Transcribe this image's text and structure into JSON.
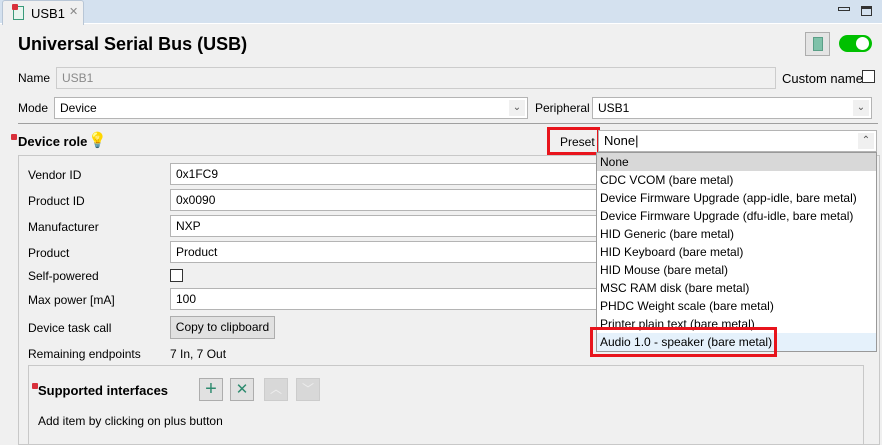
{
  "tab": {
    "label": "USB1"
  },
  "title": "Universal Serial Bus (USB)",
  "name": {
    "label": "Name",
    "value": "USB1",
    "custom_name_label": "Custom name"
  },
  "mode": {
    "label": "Mode",
    "value": "Device"
  },
  "peripheral": {
    "label": "Peripheral",
    "value": "USB1"
  },
  "device_role": {
    "label": "Device role",
    "preset_label": "Preset",
    "value": "None"
  },
  "preset_options": [
    "None",
    "CDC VCOM (bare metal)",
    "Device Firmware Upgrade (app-idle, bare metal)",
    "Device Firmware Upgrade (dfu-idle, bare metal)",
    "HID Generic (bare metal)",
    "HID Keyboard (bare metal)",
    "HID Mouse (bare metal)",
    "MSC RAM disk (bare metal)",
    "PHDC Weight scale (bare metal)",
    "Printer plain text (bare metal)",
    "Audio 1.0 - speaker (bare metal)"
  ],
  "fields": {
    "vendor_id": {
      "label": "Vendor ID",
      "value": "0x1FC9"
    },
    "product_id": {
      "label": "Product ID",
      "value": "0x0090"
    },
    "manufacturer": {
      "label": "Manufacturer",
      "value": "NXP"
    },
    "product": {
      "label": "Product",
      "value": "Product"
    },
    "self_powered": {
      "label": "Self-powered"
    },
    "max_power": {
      "label": "Max power [mA]",
      "value": "100"
    },
    "device_task_call": {
      "label": "Device task call",
      "button": "Copy to clipboard"
    },
    "remaining_endpoints": {
      "label": "Remaining endpoints",
      "value": "7 In, 7 Out"
    }
  },
  "interfaces": {
    "label": "Supported interfaces",
    "hint": "Add item by clicking on plus button"
  },
  "colors": {
    "toggle": "#00c000",
    "highlight": "#e8141c",
    "accent": "#2e8b6f"
  }
}
